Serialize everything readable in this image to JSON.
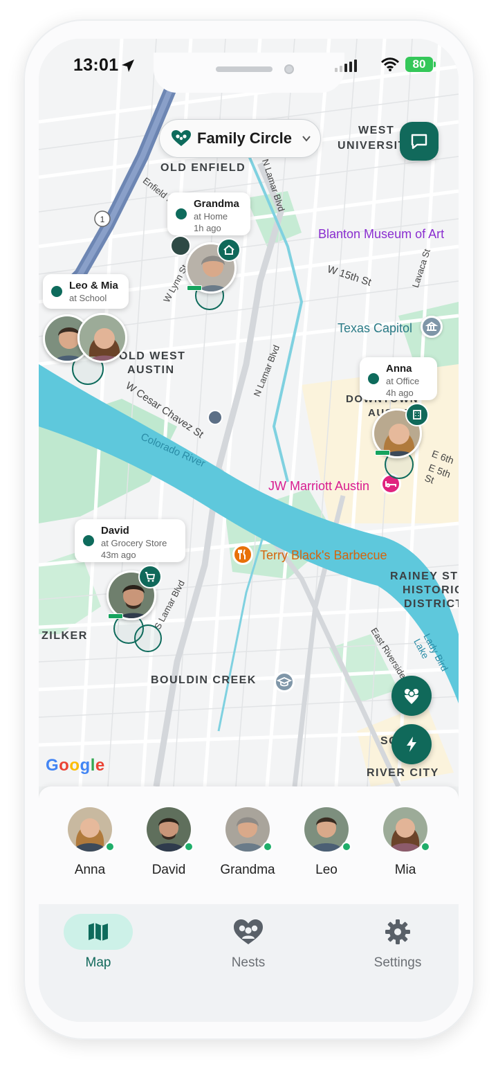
{
  "status": {
    "time": "13:01",
    "battery": "80"
  },
  "header": {
    "circle_title": "Family Circle"
  },
  "map": {
    "places": [
      "OLD ENFIELD",
      "WEST",
      "UNIVERSITY",
      "OLD WEST",
      "AUSTIN",
      "RAINEY ST",
      "HISTORIC",
      "DISTRICT",
      "ZILKER",
      "BOULDIN CREEK",
      "SOUTH",
      "RIVER CITY",
      "DOWNTOWN",
      "AUSTIN"
    ],
    "pois": {
      "blanton": "Blanton Museum of Art",
      "capitol": "Texas Capitol",
      "marriott": "JW Marriott Austin",
      "barbecue": "Terry Black's Barbecue"
    },
    "roads": [
      "Enfield Rd",
      "N Lamar Blvd",
      "W 15th St",
      "Lavaca St",
      "W Lynn St",
      "W Cesar Chavez St",
      "Colorado River",
      "N Lamar Blvd",
      "E 6th",
      "E 5th St",
      "S Lamar Blvd",
      "East Riverside",
      "Lady Bird Lake",
      "1"
    ],
    "google": "Google"
  },
  "pins": {
    "grandma": {
      "name": "Grandma",
      "place": "at Home",
      "ago": "1h ago"
    },
    "leo_mia": {
      "name": "Leo & Mia",
      "place": "at School"
    },
    "anna": {
      "name": "Anna",
      "place": "at Office",
      "ago": "4h ago"
    },
    "david": {
      "name": "David",
      "place": "at Grocery Store",
      "ago": "43m ago"
    }
  },
  "members": [
    {
      "name": "Anna",
      "online": true
    },
    {
      "name": "David",
      "online": true
    },
    {
      "name": "Grandma",
      "online": true
    },
    {
      "name": "Leo",
      "online": true
    },
    {
      "name": "Mia",
      "online": true
    }
  ],
  "tabs": [
    {
      "label": "Map",
      "icon": "map-icon",
      "active": true
    },
    {
      "label": "Nests",
      "icon": "nests-icon",
      "active": false
    },
    {
      "label": "Settings",
      "icon": "gear-icon",
      "active": false
    }
  ],
  "colors": {
    "accent": "#10695a",
    "online": "#1fae6a",
    "river": "#5ec8dc",
    "park": "#bfe8cf"
  }
}
